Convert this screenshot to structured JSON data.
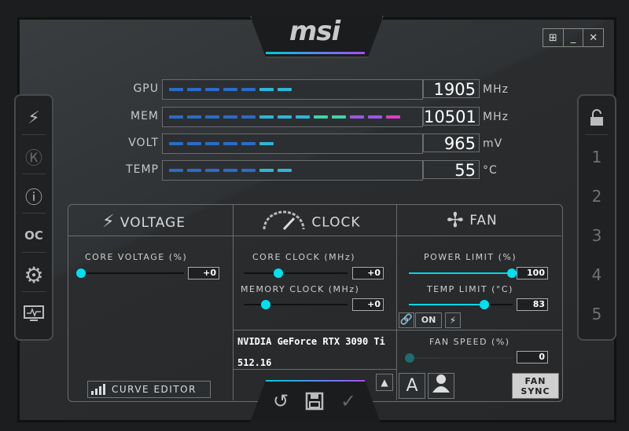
{
  "header": {
    "logo": "msi"
  },
  "window_controls": {
    "windows": "⊞",
    "minimize": "_",
    "close": "✕"
  },
  "left_sidebar": [
    {
      "name": "kombustor-icon",
      "glyph": "⚡"
    },
    {
      "name": "k-icon",
      "glyph": "Ⓚ"
    },
    {
      "name": "info-icon",
      "glyph": "ⓘ"
    },
    {
      "name": "oc-scanner-icon",
      "glyph": "OC"
    },
    {
      "name": "settings-gear-icon",
      "glyph": "⚙"
    },
    {
      "name": "monitor-icon",
      "glyph": "▭"
    }
  ],
  "right_sidebar": {
    "lock": "🔓",
    "profiles": [
      "1",
      "2",
      "3",
      "4",
      "5"
    ]
  },
  "metrics": {
    "gpu": {
      "label": "GPU",
      "value": "1905",
      "unit": "MHz",
      "level": 0.55
    },
    "mem": {
      "label": "MEM",
      "value": "10501",
      "unit": "MHz",
      "level": 0.98
    },
    "volt": {
      "label": "VOLT",
      "value": "965",
      "unit": "mV",
      "level": 0.45
    },
    "temp": {
      "label": "TEMP",
      "value": "55",
      "unit": "°C",
      "level": 0.52
    }
  },
  "sections": {
    "voltage": {
      "title": "VOLTAGE",
      "core_voltage_label": "CORE VOLTAGE  (%)",
      "core_voltage_value": "+0"
    },
    "clock": {
      "title": "CLOCK",
      "core_clock_label": "CORE CLOCK (MHz)",
      "core_clock_value": "+0",
      "memory_clock_label": "MEMORY CLOCK (MHz)",
      "memory_clock_value": "+0"
    },
    "fan": {
      "title": "FAN",
      "power_limit_label": "POWER LIMIT (%)",
      "power_limit_value": "100",
      "temp_limit_label": "TEMP LIMIT (°C)",
      "temp_limit_value": "83",
      "link_on": "ON",
      "fan_speed_label": "FAN SPEED  (%)",
      "fan_speed_value": "0",
      "auto_label": "A",
      "fan_sync_line1": "FAN",
      "fan_sync_line2": "SYNC"
    }
  },
  "gpu_info": {
    "name": "NVIDIA GeForce RTX 3090 Ti",
    "driver": "512.16"
  },
  "curve_editor": {
    "label": "CURVE EDITOR"
  },
  "colors": {
    "accent": "#00e0f0",
    "purple": "#a64cff",
    "pink": "#e03cc8"
  }
}
